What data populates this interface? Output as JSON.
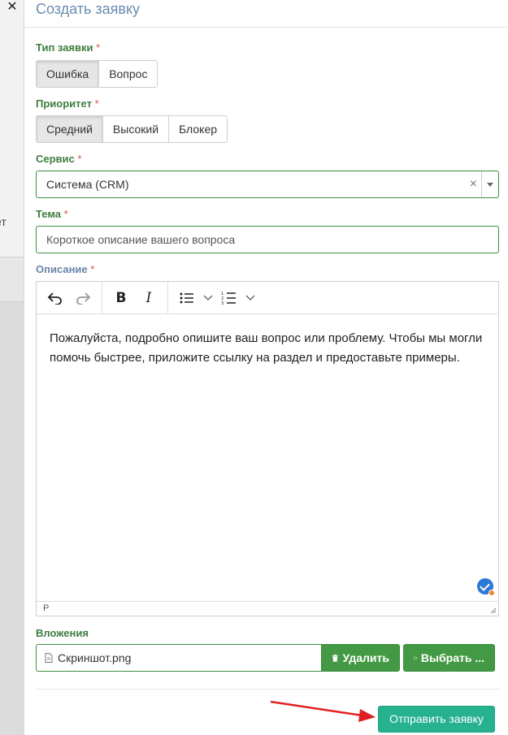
{
  "backdrop": {
    "close_symbol": "✕",
    "clipped_text": "ет"
  },
  "modal": {
    "title": "Создать заявку"
  },
  "form": {
    "type": {
      "label": "Тип заявки",
      "required": "*",
      "options": [
        "Ошибка",
        "Вопрос"
      ],
      "selected": "Ошибка"
    },
    "priority": {
      "label": "Приоритет",
      "required": "*",
      "options": [
        "Средний",
        "Высокий",
        "Блокер"
      ],
      "selected": "Средний"
    },
    "service": {
      "label": "Сервис",
      "required": "*",
      "value": "Система (CRM)",
      "clear_symbol": "×"
    },
    "subject": {
      "label": "Тема",
      "required": "*",
      "placeholder": "Короткое описание вашего вопроса"
    },
    "description": {
      "label": "Описание",
      "required": "*",
      "text": "Пожалуйста, подробно опишите ваш вопрос или проблему. Чтобы мы могли помочь быстрее, приложите ссылку на раздел и предоставьте примеры.",
      "status_path": "P",
      "toolbar": [
        "undo-icon",
        "redo-icon",
        "bold",
        "italic",
        "bullet-list-icon",
        "numbered-list-icon"
      ],
      "bold_label": "B",
      "italic_label": "I"
    },
    "attachments": {
      "label": "Вложения",
      "file_name": "Скриншот.png",
      "delete_label": "Удалить",
      "choose_label": "Выбрать ..."
    },
    "submit_label": "Отправить заявку"
  },
  "colors": {
    "label_green": "#3e7d3e",
    "label_blue": "#6b86a8",
    "title_blue": "#6b8db0",
    "button_green": "#449a44",
    "submit_teal": "#26b18f",
    "arrow_red": "#e02020"
  }
}
